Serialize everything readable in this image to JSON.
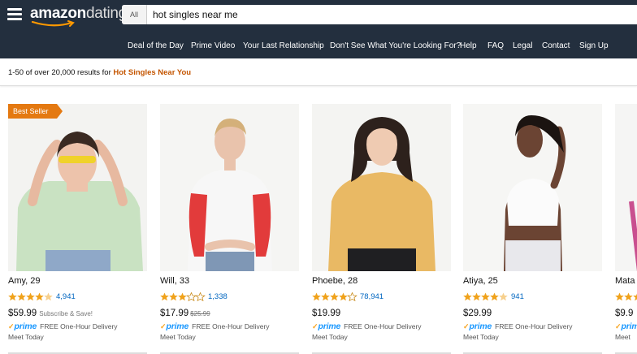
{
  "app": {
    "logo_main": "amazon",
    "logo_sub": "dating"
  },
  "search": {
    "category": "All",
    "query": "hot singles near me"
  },
  "nav": [
    "Deal of the Day",
    "Prime Video",
    "Your Last Relationship",
    "Don't See What You're Looking For?",
    "Help",
    "FAQ",
    "Legal",
    "Contact",
    "Sign Up"
  ],
  "results": {
    "summary": "1-50 of over 20,000 results for ",
    "query": "Hot Singles Near You"
  },
  "colors": {
    "header_bg": "#232f3e",
    "accent_orange": "#e47911",
    "link_blue": "#0066c0",
    "star_gold": "#f0a21b",
    "prime_blue": "#1a98ff"
  },
  "products": [
    {
      "badge": "Best Seller",
      "name": "Amy, 29",
      "rating": 4.5,
      "review_count": "4,941",
      "price": "$59.99",
      "old_price": "",
      "subscribe": "Subscribe & Save!",
      "prime_check": "✓",
      "prime": "prime",
      "delivery": "FREE One-Hour Delivery",
      "meet": "Meet Today",
      "photo_icon": "person-photo-icon"
    },
    {
      "badge": "",
      "name": "Will, 33",
      "rating": 3,
      "review_count": "1,338",
      "price": "$17.99",
      "old_price": "$25.99",
      "subscribe": "",
      "prime_check": "✓",
      "prime": "prime",
      "delivery": "FREE One-Hour Delivery",
      "meet": "Meet Today",
      "photo_icon": "person-photo-icon"
    },
    {
      "badge": "",
      "name": "Phoebe, 28",
      "rating": 4,
      "review_count": "78,941",
      "price": "$19.99",
      "old_price": "",
      "subscribe": "",
      "prime_check": "✓",
      "prime": "prime",
      "delivery": "FREE One-Hour Delivery",
      "meet": "Meet Today",
      "photo_icon": "person-photo-icon"
    },
    {
      "badge": "",
      "name": "Atiya, 25",
      "rating": 4.5,
      "review_count": "941",
      "price": "$29.99",
      "old_price": "",
      "subscribe": "",
      "prime_check": "✓",
      "prime": "prime",
      "delivery": "FREE One-Hour Delivery",
      "meet": "Meet Today",
      "photo_icon": "person-photo-icon"
    },
    {
      "badge": "",
      "name": "Mata",
      "rating": 4,
      "review_count": "",
      "price": "$9.9",
      "old_price": "",
      "subscribe": "",
      "prime_check": "✓",
      "prime": "prim",
      "delivery": "",
      "meet": "Meet",
      "photo_icon": "person-photo-icon"
    }
  ]
}
